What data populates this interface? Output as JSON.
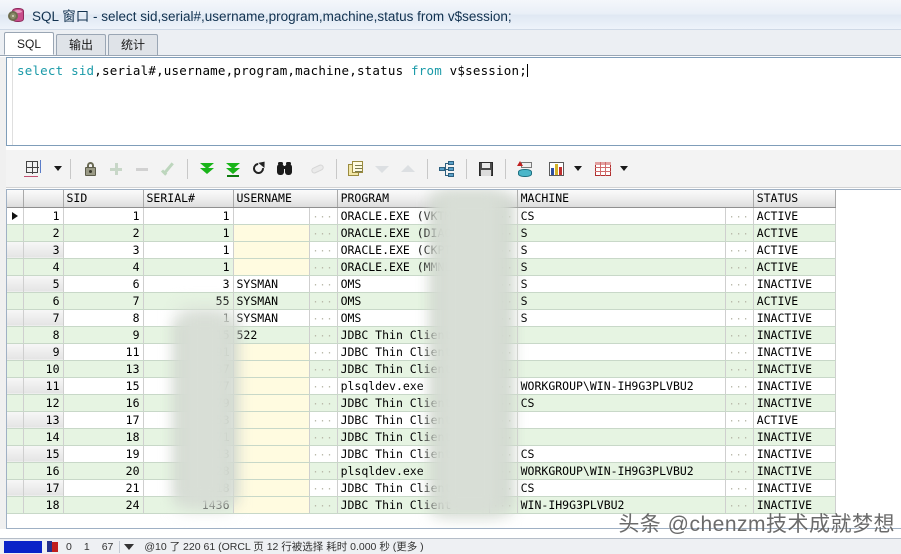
{
  "window": {
    "title": "SQL 窗口 - select sid,serial#,username,program,machine,status from v$session;",
    "icon": "sql-window-icon"
  },
  "tabs": [
    {
      "label": "SQL",
      "active": true
    },
    {
      "label": "输出",
      "active": false
    },
    {
      "label": "统计",
      "active": false
    }
  ],
  "editor": {
    "sql_tokens": [
      {
        "text": "select",
        "type": "keyword"
      },
      {
        "text": " ",
        "type": "plain"
      },
      {
        "text": "sid",
        "type": "keyword"
      },
      {
        "text": ",serial#,username,program,machine,status ",
        "type": "plain"
      },
      {
        "text": "from",
        "type": "keyword"
      },
      {
        "text": " v$session;",
        "type": "plain"
      }
    ],
    "full_sql": "select sid,serial#,username,program,machine,status from v$session;"
  },
  "toolbar": {
    "items": [
      {
        "name": "grid-size-button",
        "icon": "grid-resize-icon",
        "dropdown": true,
        "disabled": false
      },
      {
        "name": "lock-record-button",
        "icon": "lock-icon",
        "dropdown": false,
        "disabled": false
      },
      {
        "name": "insert-record-button",
        "icon": "plus-icon",
        "dropdown": false,
        "disabled": true
      },
      {
        "name": "delete-record-button",
        "icon": "minus-icon",
        "dropdown": false,
        "disabled": true
      },
      {
        "name": "post-changes-button",
        "icon": "check-icon",
        "dropdown": false,
        "disabled": true
      },
      {
        "name": "fetch-next-page-button",
        "icon": "double-down-arrow-icon",
        "dropdown": false,
        "disabled": false
      },
      {
        "name": "fetch-last-page-button",
        "icon": "double-down-arrow-bar-icon",
        "dropdown": false,
        "disabled": false
      },
      {
        "name": "refresh-button",
        "icon": "refresh-icon",
        "dropdown": false,
        "disabled": false
      },
      {
        "name": "find-button",
        "icon": "binoculars-icon",
        "dropdown": false,
        "disabled": false
      },
      {
        "name": "clear-button",
        "icon": "eraser-icon",
        "dropdown": false,
        "disabled": true
      },
      {
        "name": "copy-to-clipboard-button",
        "icon": "copy-pages-icon",
        "dropdown": false,
        "disabled": false
      },
      {
        "name": "sort-descending-button",
        "icon": "triangle-down-icon",
        "dropdown": false,
        "disabled": true
      },
      {
        "name": "sort-ascending-button",
        "icon": "triangle-up-icon",
        "dropdown": false,
        "disabled": true
      },
      {
        "name": "explain-plan-button",
        "icon": "hierarchy-icon",
        "dropdown": false,
        "disabled": false
      },
      {
        "name": "save-button",
        "icon": "floppy-save-icon",
        "dropdown": false,
        "disabled": false
      },
      {
        "name": "export-data-button",
        "icon": "database-export-icon",
        "dropdown": false,
        "disabled": false
      },
      {
        "name": "chart-button",
        "icon": "bar-chart-icon",
        "dropdown": true,
        "disabled": false
      },
      {
        "name": "grid-view-button",
        "icon": "red-grid-icon",
        "dropdown": true,
        "disabled": false
      }
    ]
  },
  "grid": {
    "columns": [
      "SID",
      "SERIAL#",
      "USERNAME",
      "PROGRAM",
      "MACHINE",
      "STATUS"
    ],
    "selected_row": 1,
    "rows": [
      {
        "n": 1,
        "SID": "1",
        "SERIAL#": "1",
        "USERNAME": "",
        "PROGRAM": "ORACLE.EXE (VKTM)",
        "MACHINE": "CS",
        "STATUS": "ACTIVE"
      },
      {
        "n": 2,
        "SID": "2",
        "SERIAL#": "1",
        "USERNAME": "",
        "PROGRAM": "ORACLE.EXE (DIAO)",
        "MACHINE": "S",
        "STATUS": "ACTIVE"
      },
      {
        "n": 3,
        "SID": "3",
        "SERIAL#": "1",
        "USERNAME": "",
        "PROGRAM": "ORACLE.EXE (CKPT)",
        "MACHINE": "S",
        "STATUS": "ACTIVE"
      },
      {
        "n": 4,
        "SID": "4",
        "SERIAL#": "1",
        "USERNAME": "",
        "PROGRAM": "ORACLE.EXE (MMNL)",
        "MACHINE": "S",
        "STATUS": "ACTIVE"
      },
      {
        "n": 5,
        "SID": "6",
        "SERIAL#": "3",
        "USERNAME": "SYSMAN",
        "PROGRAM": "OMS",
        "MACHINE": "S",
        "STATUS": "INACTIVE"
      },
      {
        "n": 6,
        "SID": "7",
        "SERIAL#": "55",
        "USERNAME": "SYSMAN",
        "PROGRAM": "OMS",
        "MACHINE": "S",
        "STATUS": "ACTIVE"
      },
      {
        "n": 7,
        "SID": "8",
        "SERIAL#": "1",
        "USERNAME": "SYSMAN",
        "PROGRAM": "OMS",
        "MACHINE": "S",
        "STATUS": "INACTIVE"
      },
      {
        "n": 8,
        "SID": "9",
        "SERIAL#": "50415",
        "USERNAME": "522",
        "PROGRAM": "JDBC Thin Client",
        "MACHINE": "",
        "STATUS": "INACTIVE"
      },
      {
        "n": 9,
        "SID": "11",
        "SERIAL#": "28891",
        "USERNAME": "",
        "PROGRAM": "JDBC Thin Client",
        "MACHINE": "",
        "STATUS": "INACTIVE"
      },
      {
        "n": 10,
        "SID": "13",
        "SERIAL#": "41637",
        "USERNAME": "",
        "PROGRAM": "JDBC Thin Client",
        "MACHINE": "",
        "STATUS": "INACTIVE"
      },
      {
        "n": 11,
        "SID": "15",
        "SERIAL#": "27377",
        "USERNAME": "",
        "PROGRAM": "plsqldev.exe",
        "MACHINE": "WORKGROUP\\WIN-IH9G3PLVBU2",
        "STATUS": "INACTIVE"
      },
      {
        "n": 12,
        "SID": "16",
        "SERIAL#": "31179",
        "USERNAME": "",
        "PROGRAM": "JDBC Thin Client",
        "MACHINE": "CS",
        "STATUS": "INACTIVE"
      },
      {
        "n": 13,
        "SID": "17",
        "SERIAL#": "42253",
        "USERNAME": "",
        "PROGRAM": "JDBC Thin Client",
        "MACHINE": "",
        "STATUS": "ACTIVE"
      },
      {
        "n": 14,
        "SID": "18",
        "SERIAL#": "3971",
        "USERNAME": "",
        "PROGRAM": "JDBC Thin Client",
        "MACHINE": "",
        "STATUS": "INACTIVE"
      },
      {
        "n": 15,
        "SID": "19",
        "SERIAL#": "2113",
        "USERNAME": "",
        "PROGRAM": "JDBC Thin Client",
        "MACHINE": "CS",
        "STATUS": "INACTIVE"
      },
      {
        "n": 16,
        "SID": "20",
        "SERIAL#": "128",
        "USERNAME": "",
        "PROGRAM": "plsqldev.exe",
        "MACHINE": "WORKGROUP\\WIN-IH9G3PLVBU2",
        "STATUS": "INACTIVE"
      },
      {
        "n": 17,
        "SID": "21",
        "SERIAL#": "4318",
        "USERNAME": "",
        "PROGRAM": "JDBC Thin Client",
        "MACHINE": "CS",
        "STATUS": "INACTIVE"
      },
      {
        "n": 18,
        "SID": "24",
        "SERIAL#": "1436",
        "USERNAME": "",
        "PROGRAM": "JDBC Thin Client",
        "MACHINE": "WIN-IH9G3PLVBU2",
        "STATUS": "INACTIVE"
      }
    ],
    "cell_overflow_marker": "···"
  },
  "statusbar": {
    "left_cells": [
      "0",
      "1",
      "67"
    ],
    "right_text": "@10 了 220 61 (ORCL   页 12 行被选择  耗时 0.000 秒 (更多   )"
  },
  "watermark": {
    "text": "头条 @chenzm技术成就梦想"
  },
  "colors": {
    "accent": "#1a9aa8",
    "row_alt": "#e6f4e2",
    "username_cell": "#fffbe0",
    "header_border": "#8f8f8f"
  }
}
